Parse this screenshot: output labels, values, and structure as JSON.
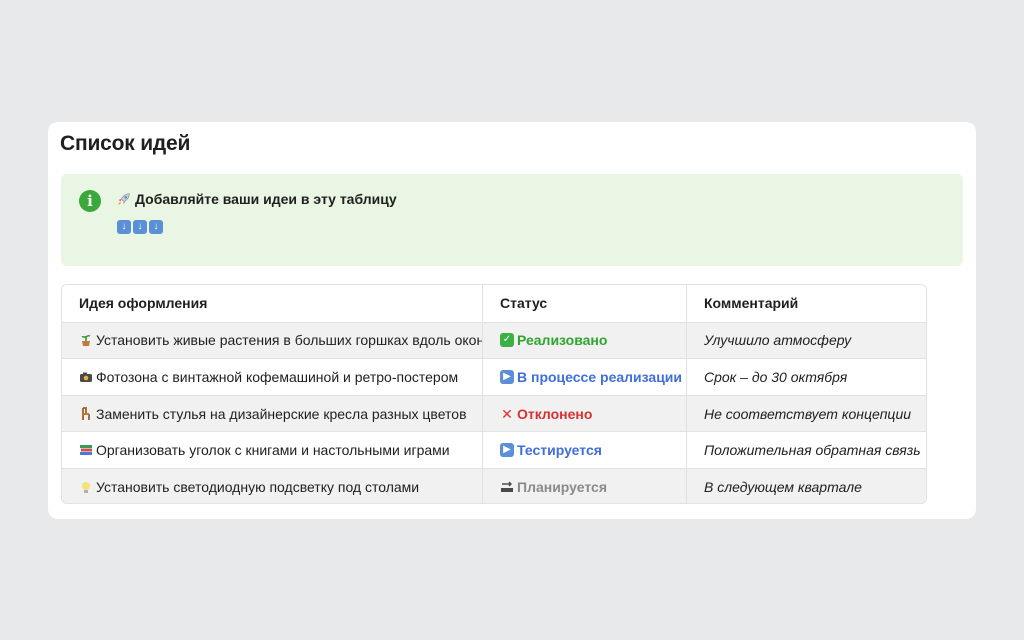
{
  "page": {
    "title": "Список идей"
  },
  "callout": {
    "icon": "info-icon",
    "text": "Добавляйте ваши идеи в эту таблицу",
    "title_icon": "rocket-icon",
    "arrow_icons": [
      "arrow-down-icon",
      "arrow-down-icon",
      "arrow-down-icon"
    ],
    "accent": "#3aa83a",
    "background": "#e8f6e3"
  },
  "table": {
    "columns": [
      "Идея оформления",
      "Статус",
      "Комментарий"
    ],
    "rows": [
      {
        "idea_icon": "potted-plant-icon",
        "idea": "Установить живые растения в больших горшках вдоль окон",
        "status_icon": "check-icon",
        "status": "Реализовано",
        "status_color": "#2fa52f",
        "comment": "Улучшило атмосферу"
      },
      {
        "idea_icon": "camera-icon",
        "idea": "Фотозона с винтажной кофемашиной и ретро-постером",
        "status_icon": "play-icon",
        "status": "В процессе реализации",
        "status_color": "#3f6fd8",
        "comment": "Срок – до 30 октября"
      },
      {
        "idea_icon": "chair-icon",
        "idea": "Заменить стулья на дизайнерские кресла разных цветов",
        "status_icon": "cross-icon",
        "status": "Отклонено",
        "status_color": "#d83030",
        "comment": "Не соответствует концепции"
      },
      {
        "idea_icon": "books-icon",
        "idea": "Организовать уголок с книгами и настольными играми",
        "status_icon": "play-icon",
        "status": "Тестируется",
        "status_color": "#3f6fd8",
        "comment": "Положительная обратная связь"
      },
      {
        "idea_icon": "light-bulb-icon",
        "idea": "Установить светодиодную подсветку под столами",
        "status_icon": "soon-icon",
        "status": "Планируется",
        "status_color": "#8a8a8a",
        "comment": "В следующем квартале"
      }
    ]
  }
}
